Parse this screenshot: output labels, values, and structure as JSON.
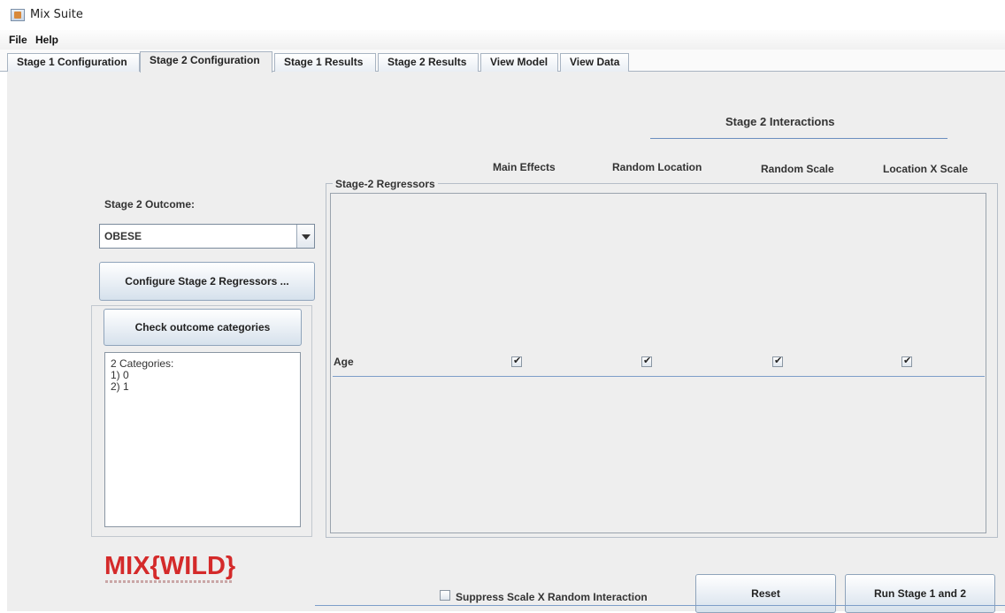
{
  "window": {
    "title": "Mix Suite"
  },
  "menu": {
    "file": "File",
    "help": "Help"
  },
  "tabs": [
    {
      "label": "Stage 1 Configuration"
    },
    {
      "label": "Stage 2 Configuration",
      "selected": true
    },
    {
      "label": "Stage 1 Results"
    },
    {
      "label": "Stage 2 Results"
    },
    {
      "label": "View Model"
    },
    {
      "label": "View Data"
    }
  ],
  "left": {
    "outcome_label": "Stage 2 Outcome:",
    "outcome_value": "OBESE",
    "configure_button": "Configure Stage 2 Regressors ...",
    "check_button": "Check outcome categories",
    "categories_lines": [
      "2 Categories:",
      "1) 0",
      "2) 1"
    ]
  },
  "interactions": {
    "title": "Stage 2 Interactions",
    "columns": [
      "Main Effects",
      "Random Location",
      "Random Scale",
      "Location X Scale"
    ]
  },
  "regressors": {
    "group_title": "Stage-2 Regressors",
    "rows": [
      {
        "name": "Age",
        "main_effects": true,
        "random_location": true,
        "random_scale": true,
        "location_x_scale": true
      }
    ]
  },
  "bottom": {
    "suppress_label": "Suppress Scale X Random Interaction",
    "suppress_checked": false,
    "reset_button": "Reset",
    "run_button": "Run Stage 1 and 2"
  },
  "logo": {
    "text": "MIX{WILD}"
  },
  "colors": {
    "accent_line": "#7d9ec9",
    "logo_red": "#d42a2a",
    "panel_bg": "#eeeeee"
  },
  "icons": {
    "app": "java-cup-icon",
    "dropdown": "chevron-down-icon",
    "check": "check-icon"
  }
}
